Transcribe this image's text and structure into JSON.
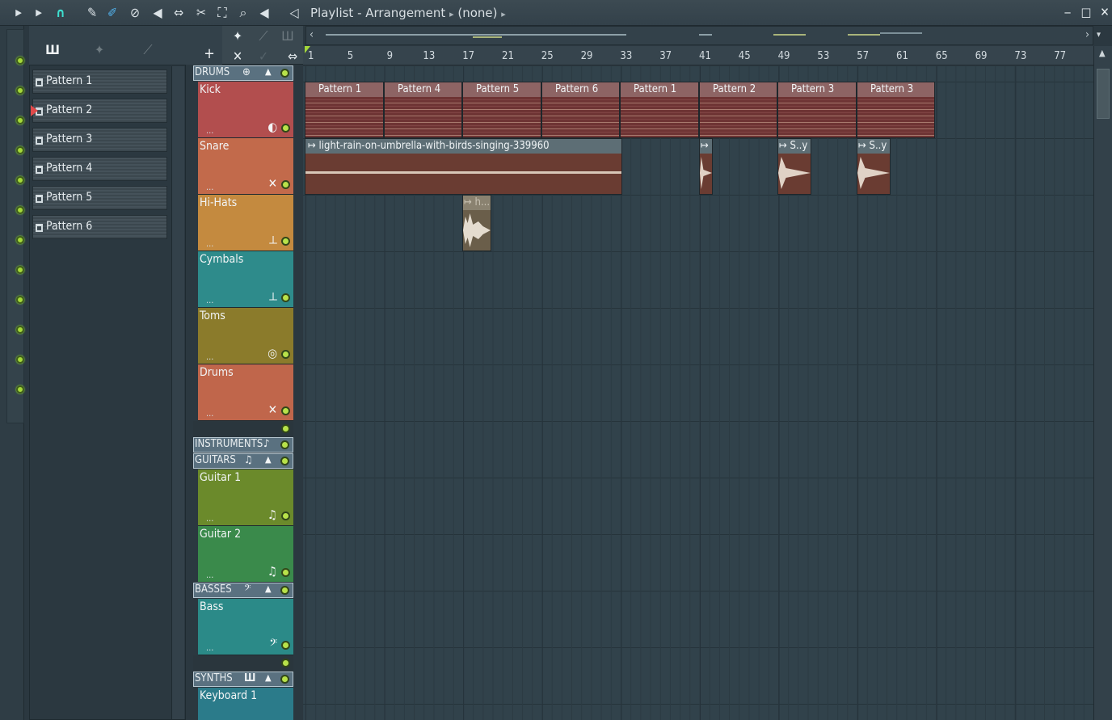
{
  "title": {
    "playlist": "Playlist - Arrangement",
    "sep1": "▸",
    "pattern": "(none)",
    "sep2": "▸"
  },
  "colors": {
    "bg": "#2b3840",
    "led": "#a4d83a",
    "kick": "#b04b4b",
    "snare": "#c16b4a",
    "hihats": "#c4883e",
    "cymbals": "#2e8a8a",
    "toms": "#8a7a2a",
    "drums": "#c0654a",
    "guitar1": "#6a8a2a",
    "guitar2": "#3a8a4a",
    "bass": "#2a8a88",
    "keys": "#2a7a8a"
  },
  "picker": {
    "add": "+",
    "items": [
      "Pattern 1",
      "Pattern 2",
      "Pattern 3",
      "Pattern 4",
      "Pattern 5",
      "Pattern 6"
    ],
    "selected": "Pattern 2"
  },
  "ruler": [
    "1",
    "5",
    "9",
    "13",
    "17",
    "21",
    "25",
    "29",
    "33",
    "37",
    "41",
    "45",
    "49",
    "53",
    "57",
    "61",
    "65",
    "69",
    "73",
    "77"
  ],
  "groups": {
    "drums": "DRUMS",
    "instruments": "INSTRUMENTS",
    "guitars": "GUITARS",
    "basses": "BASSES",
    "synths": "SYNTHS"
  },
  "tracks": {
    "dots": "...",
    "kick": "Kick",
    "snare": "Snare",
    "hihats": "Hi-Hats",
    "cymbals": "Cymbals",
    "toms": "Toms",
    "drums": "Drums",
    "guitar1": "Guitar 1",
    "guitar2": "Guitar 2",
    "bass": "Bass",
    "keyboard1": "Keyboard 1"
  },
  "clips": {
    "kick": [
      "Pattern 1",
      "Pattern 4",
      "Pattern 5",
      "Pattern 6",
      "Pattern 1",
      "Pattern 2",
      "Pattern 3",
      "Pattern 3"
    ],
    "audio": [
      "light-rain-on-umbrella-with-birds-singing-339960",
      "",
      "S..y",
      "S..y"
    ],
    "hihat": "h..."
  },
  "icons": [
    "play-icon",
    "magnet-icon",
    "pencil-icon",
    "paint-icon",
    "delete-icon",
    "mute-icon",
    "slip-icon",
    "slice-icon",
    "select-icon",
    "zoom-icon",
    "playback-icon",
    "speaker-icon",
    "minimize-icon",
    "maximize-icon",
    "close-icon"
  ]
}
